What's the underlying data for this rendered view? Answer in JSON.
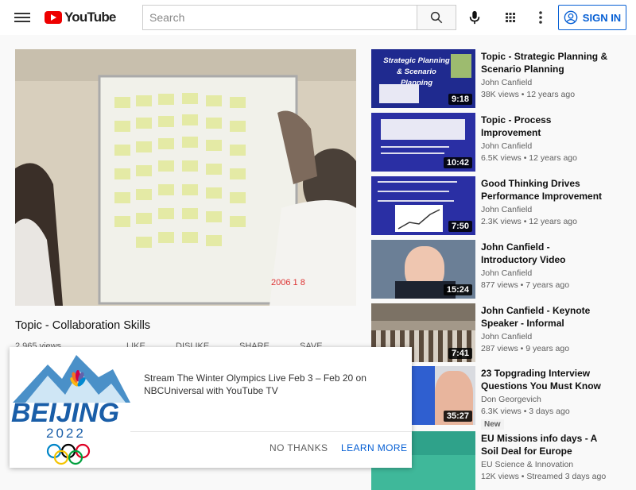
{
  "header": {
    "logo_text": "YouTube",
    "search_placeholder": "Search",
    "signin_label": "SIGN IN"
  },
  "video": {
    "title": "Topic - Collaboration Skills",
    "views": "2,965 views",
    "like_label": "LIKE",
    "dislike_label": "DISLIKE",
    "share_label": "SHARE",
    "save_label": "SAVE",
    "timestamp_overlay": "2006 1 8"
  },
  "recommendations": [
    {
      "title": "Topic - Strategic Planning & Scenario Planning",
      "channel": "John Canfield",
      "meta": "38K views • 12 years ago",
      "duration": "9:18",
      "thumb_text": "Strategic Planning & Scenario Planning"
    },
    {
      "title": "Topic - Process Improvement",
      "channel": "John Canfield",
      "meta": "6.5K views • 12 years ago",
      "duration": "10:42"
    },
    {
      "title": "Good Thinking Drives Performance Improvement &…",
      "channel": "John Canfield",
      "meta": "2.3K views • 12 years ago",
      "duration": "7:50"
    },
    {
      "title": "John Canfield - Introductory Video",
      "channel": "John Canfield",
      "meta": "877 views • 7 years ago",
      "duration": "15:24"
    },
    {
      "title": "John Canfield - Keynote Speaker - Informal",
      "channel": "John Canfield",
      "meta": "287 views • 9 years ago",
      "duration": "7:41"
    },
    {
      "title": "23 Topgrading Interview Questions You Must Know",
      "channel": "Don Georgevich",
      "meta": "6.3K views • 3 days ago",
      "duration": "35:27",
      "badge": "New"
    },
    {
      "title": "EU Missions info days - A Soil Deal for Europe Mission",
      "channel": "EU Science & Innovation",
      "meta": "12K views • Streamed 3 days ago",
      "duration": ""
    }
  ],
  "promo": {
    "text": "Stream The Winter Olympics Live Feb 3 – Feb 20 on NBCUniversal with YouTube TV",
    "logo_word": "BEIJING",
    "logo_year": "2022",
    "no_thanks_label": "NO THANKS",
    "learn_more_label": "LEARN MORE"
  },
  "colors": {
    "accent": "#065fd4",
    "youtube_red": "#ff0000"
  }
}
